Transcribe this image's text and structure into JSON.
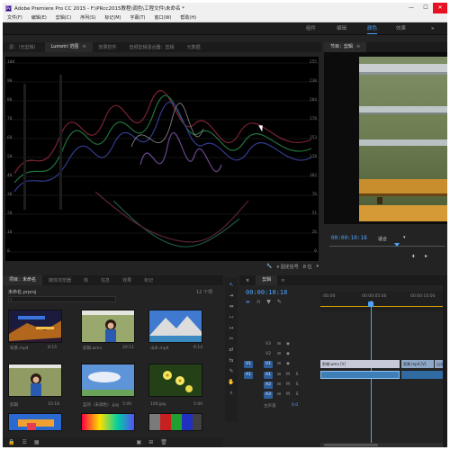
{
  "window": {
    "title": "Adobe Premiere Pro CC 2015 - F:\\PRcc2015教程\\调色\\工程文件\\未命名 *",
    "app_icon": "Pr"
  },
  "menu": [
    "文件(F)",
    "编辑(E)",
    "剪辑(C)",
    "序列(S)",
    "标记(M)",
    "字幕(T)",
    "窗口(W)",
    "帮助(H)"
  ],
  "workspaces": {
    "items": [
      "组件",
      "编辑",
      "颜色",
      "效果"
    ],
    "active": "颜色",
    "more": "»"
  },
  "scopes_panel": {
    "tabs": [
      "源：（无剪辑）",
      "Lumetri 范围",
      "效果控件",
      "音频剪辑混合器：剪辑",
      "元数据"
    ],
    "active_tab": "Lumetri 范围",
    "left_scale": [
      "100",
      "90",
      "80",
      "70",
      "60",
      "50",
      "40",
      "30",
      "20",
      "10",
      "0"
    ],
    "right_scale": [
      "255",
      "230",
      "204",
      "178",
      "153",
      "128",
      "102",
      "76",
      "51",
      "26",
      "0"
    ],
    "bottom_left_label": "0",
    "footer_mode_label": "▾ 固定信号",
    "footer_value": "8 位"
  },
  "program_monitor": {
    "tab_label": "节目：剪辑",
    "timecode": "00:00:10:18",
    "fit_label": "适合"
  },
  "project_panel": {
    "tab_label": "项目：未命名",
    "other_tabs": [
      "媒体浏览器",
      "库",
      "信息",
      "效果",
      "标记"
    ],
    "project_file": "未命名.prproj",
    "item_count": "12 个项",
    "items": [
      {
        "name": "背景.mp4",
        "duration": "8:15"
      },
      {
        "name": "剪辑.wmv",
        "duration": "20:11"
      },
      {
        "name": "山水.mp4",
        "duration": "6:14"
      },
      {
        "name": "剪辑",
        "duration": "10:18"
      },
      {
        "name": "蓝的（未调色）.jpg",
        "duration": "5:00"
      },
      {
        "name": "100.jpg",
        "duration": "5:00"
      },
      {
        "name": "",
        "duration": ""
      },
      {
        "name": "",
        "duration": ""
      },
      {
        "name": "",
        "duration": ""
      }
    ]
  },
  "timeline": {
    "tab_label": "剪辑",
    "timecode": "00:00:10:18",
    "ruler": [
      ":00:00",
      "00:00:05:00",
      "00:00:10:00"
    ],
    "master_label": "主声道",
    "master_value": "0.0",
    "video_clips": [
      "剪辑.wmv [V]",
      "背景.mp4 [V]",
      "山水"
    ],
    "tracks": {
      "video": [
        "V3",
        "V2",
        "V1"
      ],
      "audio": [
        "A1",
        "A2",
        "A3"
      ],
      "source_patch_video": "V1",
      "source_patch_audio": "A1"
    }
  },
  "colors": {
    "accent": "#4da3ff",
    "panel": "#232323",
    "video_clip": "#a4a6d8",
    "audio_clip": "#3f7fb7"
  }
}
